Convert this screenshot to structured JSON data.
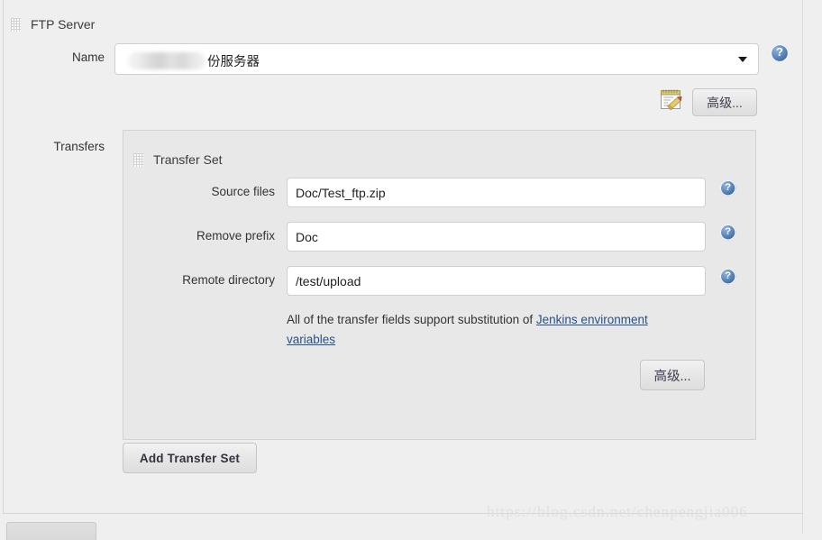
{
  "section": {
    "title": "FTP Server",
    "grip_icon": "drag-handle-icon"
  },
  "name_row": {
    "label": "Name",
    "value_visible": "份服务器",
    "redacted": true,
    "dropdown_icon": "chevron-down-icon",
    "help_icon": "help-icon"
  },
  "top_actions": {
    "note_icon": "notepad-edit-icon",
    "advanced_label": "高级..."
  },
  "transfers": {
    "label": "Transfers",
    "set_title": "Transfer Set",
    "grip_icon": "drag-handle-icon",
    "fields": [
      {
        "label": "Source files",
        "value": "Doc/Test_ftp.zip",
        "placeholder": "",
        "help_icon": "help-icon"
      },
      {
        "label": "Remove prefix",
        "value": "Doc",
        "placeholder": "",
        "help_icon": "help-icon"
      },
      {
        "label": "Remote directory",
        "value": "/test/upload",
        "placeholder": "",
        "help_icon": "help-icon"
      }
    ],
    "hint_prefix": "All of the transfer fields support substitution of ",
    "hint_link": "Jenkins environment variables",
    "advanced_label": "高级...",
    "add_transfer_set_label": "Add Transfer Set"
  },
  "watermark": "https://blog.csdn.net/chenpengjia006",
  "colors": {
    "page_bg": "#efefef",
    "panel_bg": "#e8e8e8",
    "input_bg": "#ffffff",
    "border": "#d2d2d2",
    "link": "#28518a",
    "help_blue": "#5b85bb",
    "text": "#333333"
  }
}
